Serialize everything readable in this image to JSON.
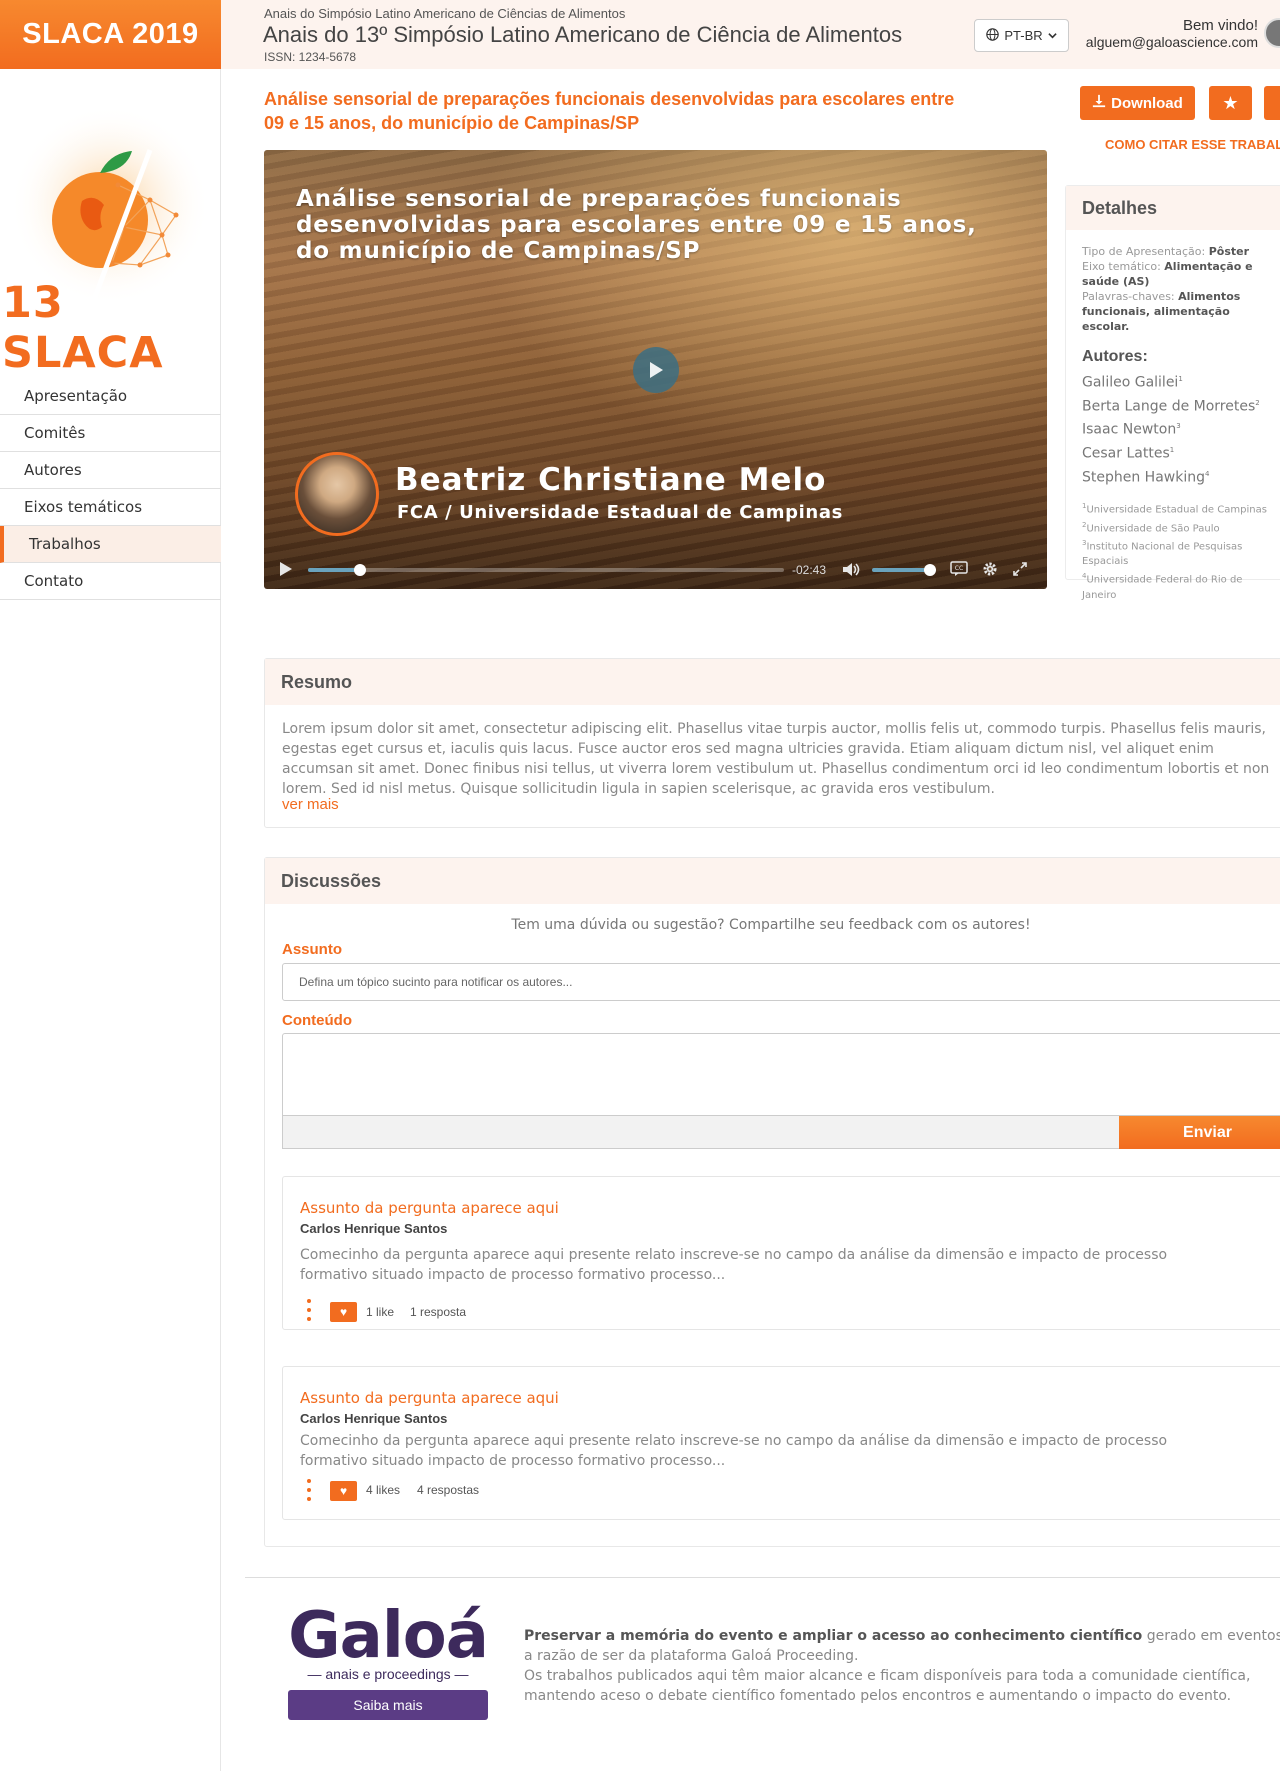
{
  "sidebar": {
    "brand": "SLACA 2019",
    "logo_text": "13 SLACA",
    "nav": [
      {
        "label": "Apresentação"
      },
      {
        "label": "Comitês"
      },
      {
        "label": "Autores"
      },
      {
        "label": "Eixos temáticos"
      },
      {
        "label": "Trabalhos",
        "active": true
      },
      {
        "label": "Contato"
      }
    ]
  },
  "header": {
    "pretitle": "Anais do Simpósio Latino Americano de Ciências de Alimentos",
    "title": "Anais do 13º Simpósio Latino Americano de Ciência de Alimentos",
    "issn": "ISSN: 1234-5678",
    "language": "PT-BR",
    "welcome": "Bem vindo!",
    "email": "alguem@galoascience.com"
  },
  "work": {
    "title": "Análise sensorial de preparações funcionais desenvolvidas para escolares entre 09 e 15 anos, do município de Campinas/SP",
    "download_label": "Download",
    "cite_label": "COMO CITAR ESSE TRABALHO?"
  },
  "video": {
    "title": "Análise sensorial de preparações funcionais desenvolvidas para escolares entre 09 e 15 anos, do município de Campinas/SP",
    "speaker_name": "Beatriz Christiane Melo",
    "speaker_institution": "FCA / Universidade Estadual de Campinas",
    "time_remaining": "-02:43",
    "progress": 0.11,
    "volume": 0.82
  },
  "details": {
    "heading": "Detalhes",
    "presentation_type_label": "Tipo de Apresentação:",
    "presentation_type": "Pôster",
    "axis_label": "Eixo temático:",
    "axis": "Alimentação e saúde (AS)",
    "keywords_label": "Palavras-chaves:",
    "keywords": "Alimentos funcionais, alimentação escolar.",
    "authors_heading": "Autores:",
    "authors": [
      {
        "name": "Galileo Galilei",
        "sup": "1"
      },
      {
        "name": "Berta Lange de Morretes",
        "sup": "2"
      },
      {
        "name": "Isaac Newton",
        "sup": "3"
      },
      {
        "name": "Cesar Lattes",
        "sup": "1"
      },
      {
        "name": "Stephen Hawking",
        "sup": "4"
      }
    ],
    "affiliations": [
      {
        "sup": "1",
        "name": "Universidade Estadual de Campinas"
      },
      {
        "sup": "2",
        "name": "Universidade de São Paulo"
      },
      {
        "sup": "3",
        "name": "Instituto Nacional de Pesquisas Espaciais"
      },
      {
        "sup": "4",
        "name": "Universidade Federal do Rio de Janeiro"
      }
    ]
  },
  "resumo": {
    "heading": "Resumo",
    "lines": [
      "Lorem ipsum dolor sit amet, consectetur adipiscing elit. Phasellus vitae turpis auctor, mollis felis ut, commodo turpis. Phasellus felis mauris,",
      "egestas eget cursus et, iaculis quis lacus. Fusce auctor eros sed magna ultricies gravida. Etiam aliquam dictum nisl, vel aliquet enim",
      "accumsan sit amet. Donec finibus nisi tellus, ut viverra lorem vestibulum ut. Phasellus condimentum orci id leo condimentum lobortis et non",
      "lorem. Sed id nisl metus. Quisque sollicitudin ligula in sapien scelerisque, ac gravida eros vestibulum."
    ],
    "more_label": "ver mais"
  },
  "discussions": {
    "heading": "Discussões",
    "prompt": "Tem uma dúvida ou sugestão? Compartilhe seu feedback com os autores!",
    "subject_label": "Assunto",
    "subject_placeholder": "Defina um tópico sucinto para notificar os autores...",
    "content_label": "Conteúdo",
    "send_label": "Enviar",
    "questions": [
      {
        "title": "Assunto da pergunta aparece aqui",
        "author": "Carlos Henrique Santos",
        "body_line1": "Comecinho da pergunta aparece aqui presente relato inscreve-se no campo da análise da dimensão e impacto de processo",
        "body_line2": "formativo situado impacto de processo formativo processo...",
        "likes": "1 like",
        "replies": "1 resposta"
      },
      {
        "title": "Assunto da pergunta aparece aqui",
        "author": "Carlos Henrique Santos",
        "body_line1": "Comecinho da pergunta aparece aqui presente relato inscreve-se no campo da análise da dimensão e impacto de processo",
        "body_line2": "formativo situado impacto de processo formativo processo...",
        "likes": "4 likes",
        "replies": "4 respostas"
      }
    ]
  },
  "footer": {
    "logo_word": "Galoá",
    "logo_sub": "anais e proceedings",
    "cta_label": "Saiba mais",
    "text_bold": "Preservar a memória do evento e ampliar o acesso ao conhecimento científico",
    "text_rest1": " gerado em eventos é",
    "text_line2": "a razão de ser da plataforma Galoá Proceeding.",
    "text_line3": "Os trabalhos publicados aqui têm maior alcance e ficam disponíveis para toda a comunidade científica,",
    "text_line4": "mantendo aceso o debate científico fomentado pelos encontros e aumentando o impacto do evento."
  },
  "colors": {
    "accent": "#f26c1f",
    "header_bg": "#fdf3ee",
    "footer_brand": "#3d2a5c",
    "footer_button": "#5b3c85"
  }
}
